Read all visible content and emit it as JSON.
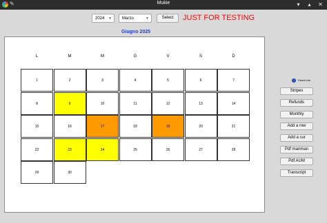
{
  "window": {
    "title": "Mukie"
  },
  "toolbar": {
    "year_value": "2024",
    "month_value": "Marzo",
    "select_label": "Select",
    "testing_text": "JUST FOR TESTING"
  },
  "calendar": {
    "title": "Giugno 2025",
    "weekdays": [
      "L",
      "M",
      "M",
      "G",
      "V",
      "S",
      "D"
    ],
    "days": [
      {
        "day": "1",
        "color": "white"
      },
      {
        "day": "2",
        "color": "white"
      },
      {
        "day": "3",
        "color": "white"
      },
      {
        "day": "4",
        "color": "white"
      },
      {
        "day": "5",
        "color": "white"
      },
      {
        "day": "6",
        "color": "white"
      },
      {
        "day": "7",
        "color": "white"
      },
      {
        "day": "8",
        "color": "white"
      },
      {
        "day": "9",
        "color": "yellow"
      },
      {
        "day": "10",
        "color": "white"
      },
      {
        "day": "11",
        "color": "white"
      },
      {
        "day": "12",
        "color": "white"
      },
      {
        "day": "13",
        "color": "white"
      },
      {
        "day": "14",
        "color": "white"
      },
      {
        "day": "15",
        "color": "white"
      },
      {
        "day": "16",
        "color": "white"
      },
      {
        "day": "17",
        "color": "orange"
      },
      {
        "day": "18",
        "color": "white"
      },
      {
        "day": "19",
        "color": "orange"
      },
      {
        "day": "20",
        "color": "white"
      },
      {
        "day": "21",
        "color": "white"
      },
      {
        "day": "22",
        "color": "white"
      },
      {
        "day": "23",
        "color": "yellow"
      },
      {
        "day": "24",
        "color": "yellow"
      },
      {
        "day": "25",
        "color": "white"
      },
      {
        "day": "26",
        "color": "white"
      },
      {
        "day": "27",
        "color": "white"
      },
      {
        "day": "28",
        "color": "white"
      },
      {
        "day": "29",
        "color": "white"
      },
      {
        "day": "30",
        "color": "white"
      }
    ]
  },
  "sidebar": {
    "radio_label": "Direct info",
    "buttons": [
      "Stripes",
      "Refunds",
      "Monthly",
      "Add a row",
      "Add a cur",
      "Pdf manman",
      "Pdf AUM",
      "Transcript"
    ]
  },
  "colors": {
    "yellow": "#ffff00",
    "orange": "#ff9900",
    "title_blue": "#1f3fd9",
    "testing_red": "#ff0000"
  }
}
